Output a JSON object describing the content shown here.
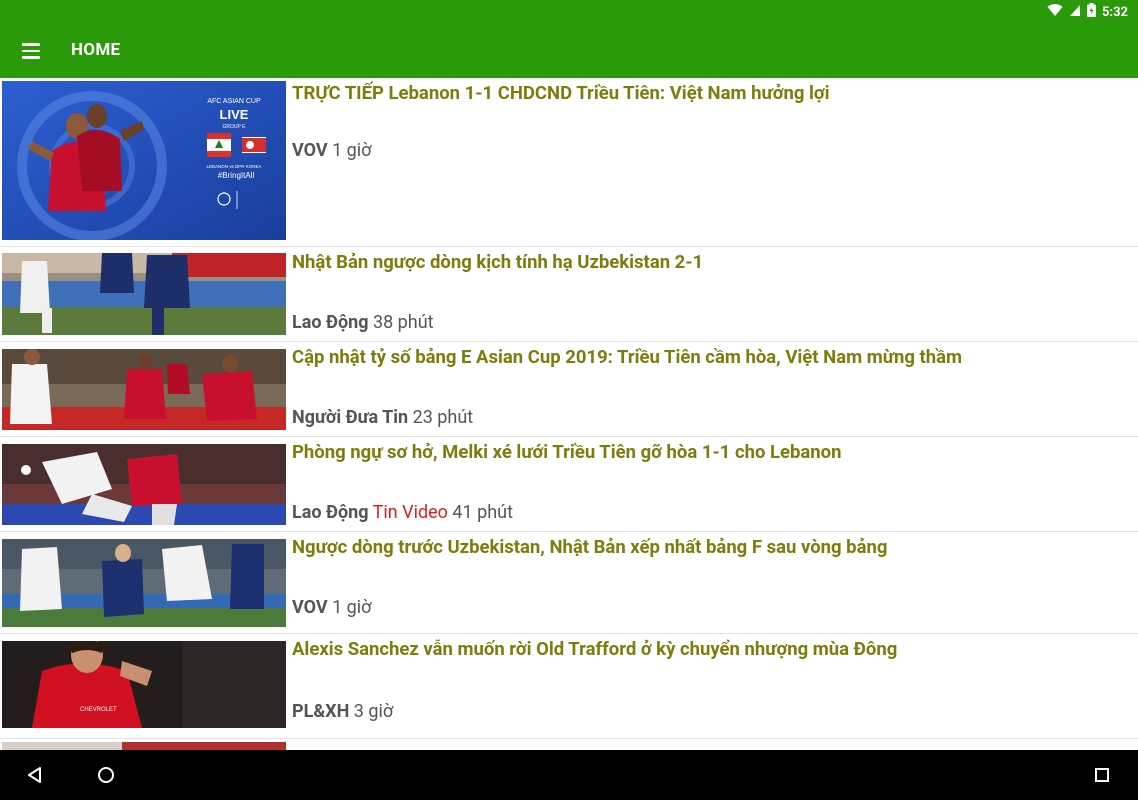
{
  "status_bar": {
    "time": "5:32"
  },
  "app_bar": {
    "title": "HOME"
  },
  "colors": {
    "primary": "#2a9a0a",
    "headline": "#7e7c0c",
    "tag_red": "#e02020"
  },
  "articles": [
    {
      "title": "TRỰC TIẾP Lebanon 1-1 CHDCND Triều Tiên: Việt Nam hưởng lợi",
      "source": "VOV",
      "tag": "",
      "time": "1 giờ",
      "thumb": {
        "banner_top": "AFC ASIAN CUP",
        "banner_live": "LIVE",
        "banner_group": "GROUP E",
        "hashtag": "#BringItAll",
        "teams": "LEBANON vs DPR KOREA"
      }
    },
    {
      "title": "Nhật Bản ngược dòng kịch tính hạ Uzbekistan 2-1",
      "source": "Lao Động",
      "tag": "",
      "time": "38 phút"
    },
    {
      "title": "Cập nhật tỷ số bảng E Asian Cup 2019: Triều Tiên cầm hòa, Việt Nam mừng thầm",
      "source": "Người Đưa Tin",
      "tag": "",
      "time": "23 phút"
    },
    {
      "title": "Phòng ngự sơ hở, Melki xé lưới Triều Tiên gỡ hòa 1-1 cho Lebanon",
      "source": "Lao Động",
      "tag": "Tin Video",
      "time": "41 phút"
    },
    {
      "title": "Ngược dòng trước Uzbekistan, Nhật Bản xếp nhất bảng F sau vòng bảng",
      "source": "VOV",
      "tag": "",
      "time": "1 giờ"
    },
    {
      "title": "Alexis Sanchez vẫn muốn rời Old Trafford ở kỳ chuyển nhượng mùa Đông",
      "source": "PL&XH",
      "tag": "",
      "time": "3 giờ"
    },
    {
      "title": "",
      "source": "",
      "tag": "",
      "time": ""
    }
  ]
}
